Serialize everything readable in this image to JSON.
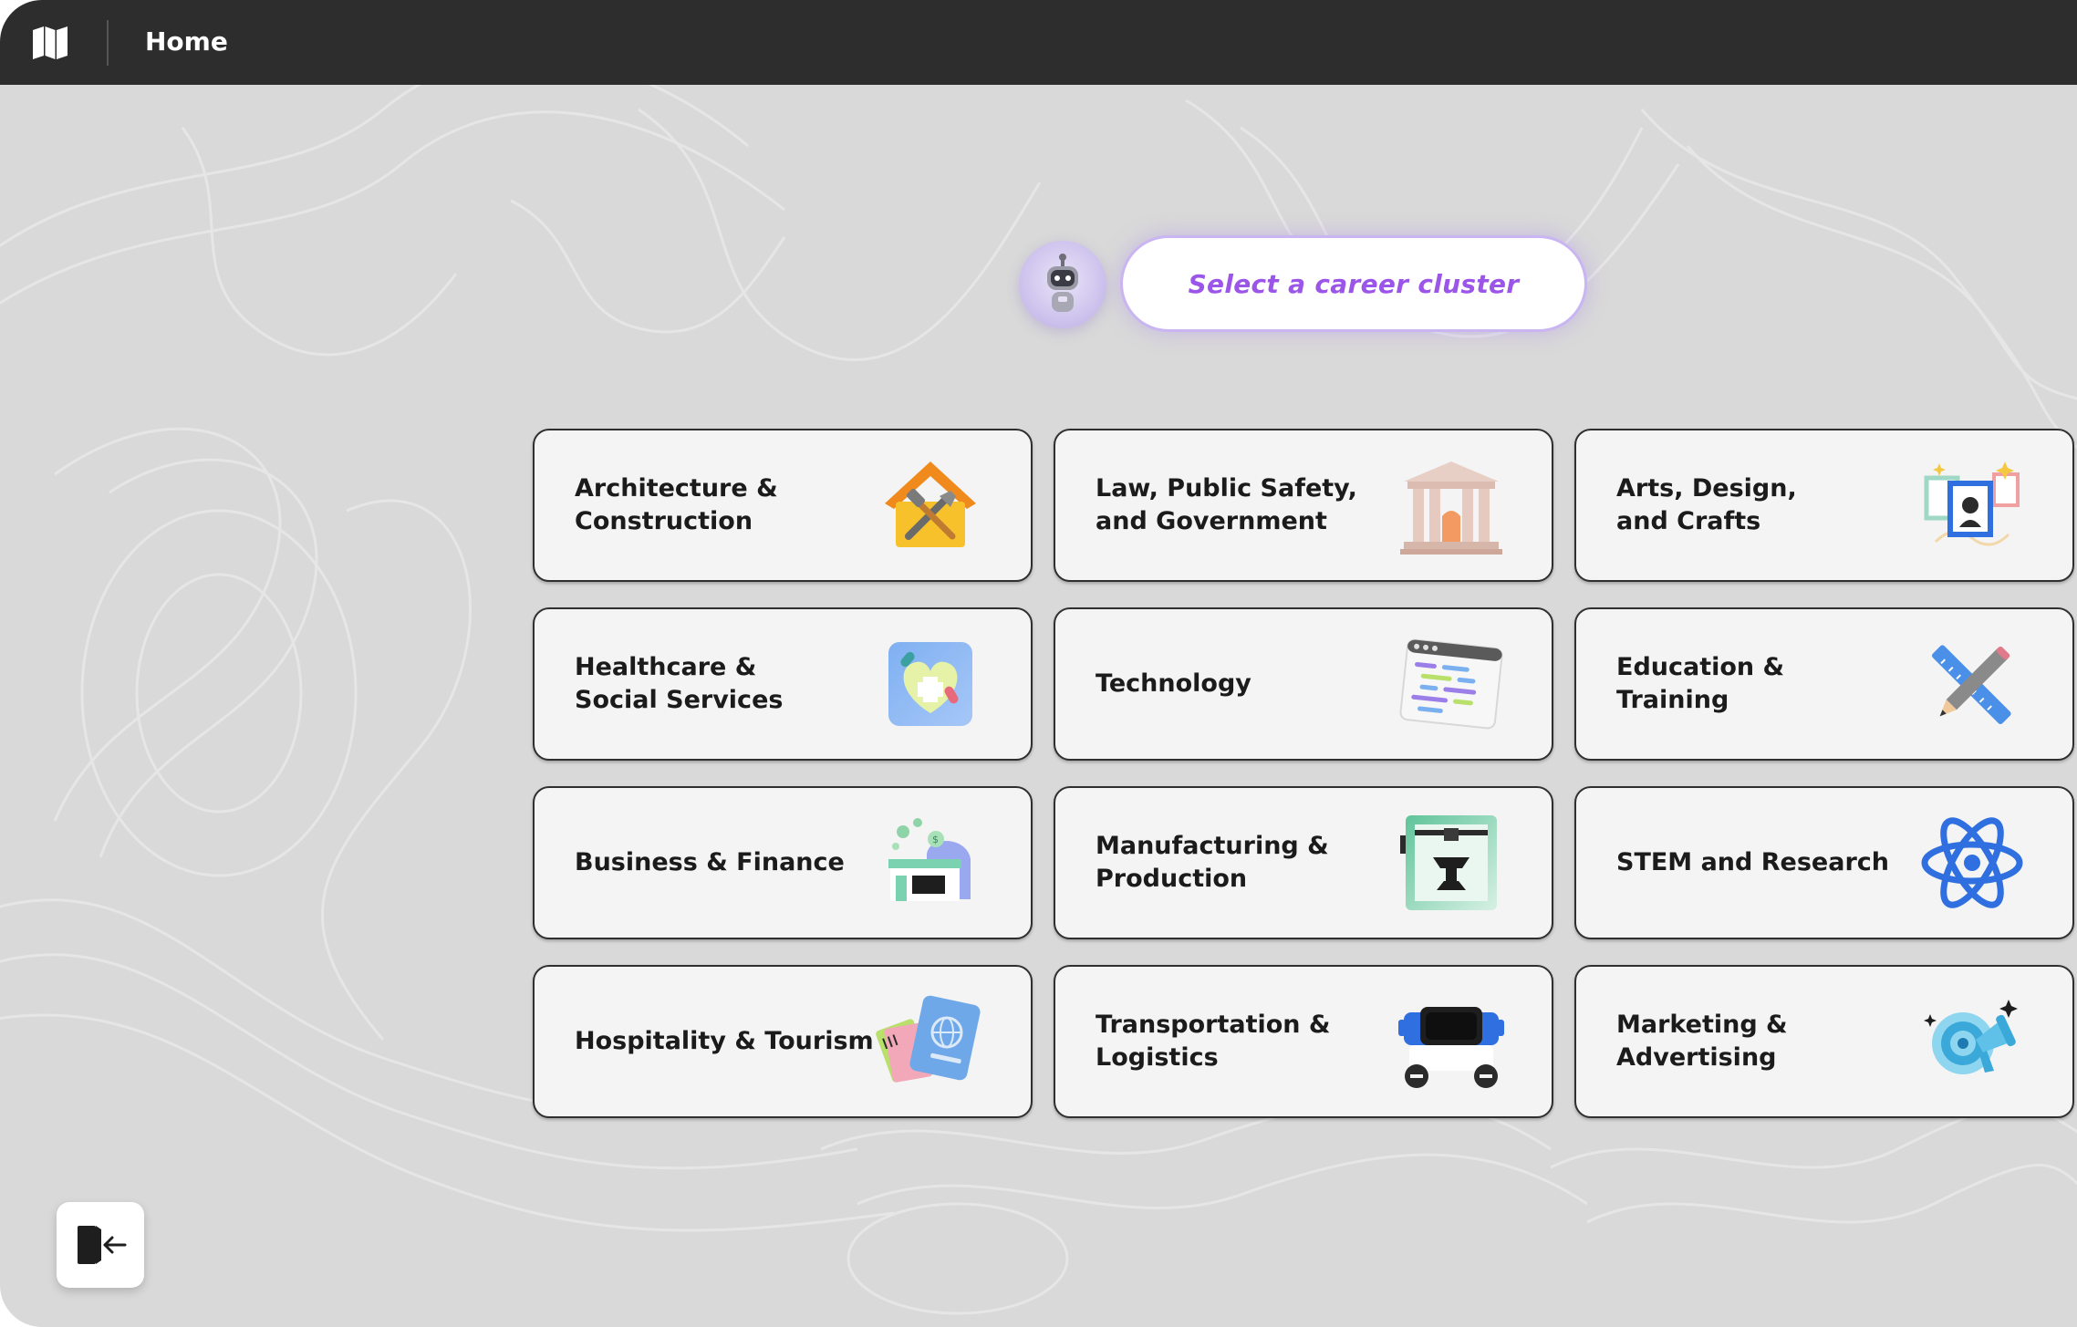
{
  "topbar": {
    "title": "Home",
    "map_icon": "map-icon"
  },
  "assistant": {
    "icon": "robot-avatar-icon",
    "prompt": "Select a career cluster"
  },
  "clusters": [
    {
      "label": "Architecture &\nConstruction",
      "icon": "house-tools-icon"
    },
    {
      "label": "Law, Public Safety,\nand Government",
      "icon": "courthouse-icon"
    },
    {
      "label": "Arts, Design,\nand Crafts",
      "icon": "picture-frames-icon"
    },
    {
      "label": "Healthcare &\nSocial Services",
      "icon": "heart-cross-icon"
    },
    {
      "label": "Technology",
      "icon": "code-window-icon"
    },
    {
      "label": "Education &\nTraining",
      "icon": "ruler-pencil-icon"
    },
    {
      "label": "Business & Finance",
      "icon": "storefront-coins-icon"
    },
    {
      "label": "Manufacturing &\nProduction",
      "icon": "3d-printer-icon"
    },
    {
      "label": "STEM and Research",
      "icon": "atom-icon"
    },
    {
      "label": "Hospitality & Tourism",
      "icon": "passport-tickets-icon"
    },
    {
      "label": "Transportation &\nLogistics",
      "icon": "bus-icon"
    },
    {
      "label": "Marketing &\nAdvertising",
      "icon": "megaphone-target-icon"
    }
  ],
  "footer": {
    "exit_icon": "exit-door-icon"
  },
  "colors": {
    "topbar": "#2d2d2d",
    "background": "#d9d9d9",
    "card": "#f4f4f4",
    "accent": "#9b55e8"
  }
}
